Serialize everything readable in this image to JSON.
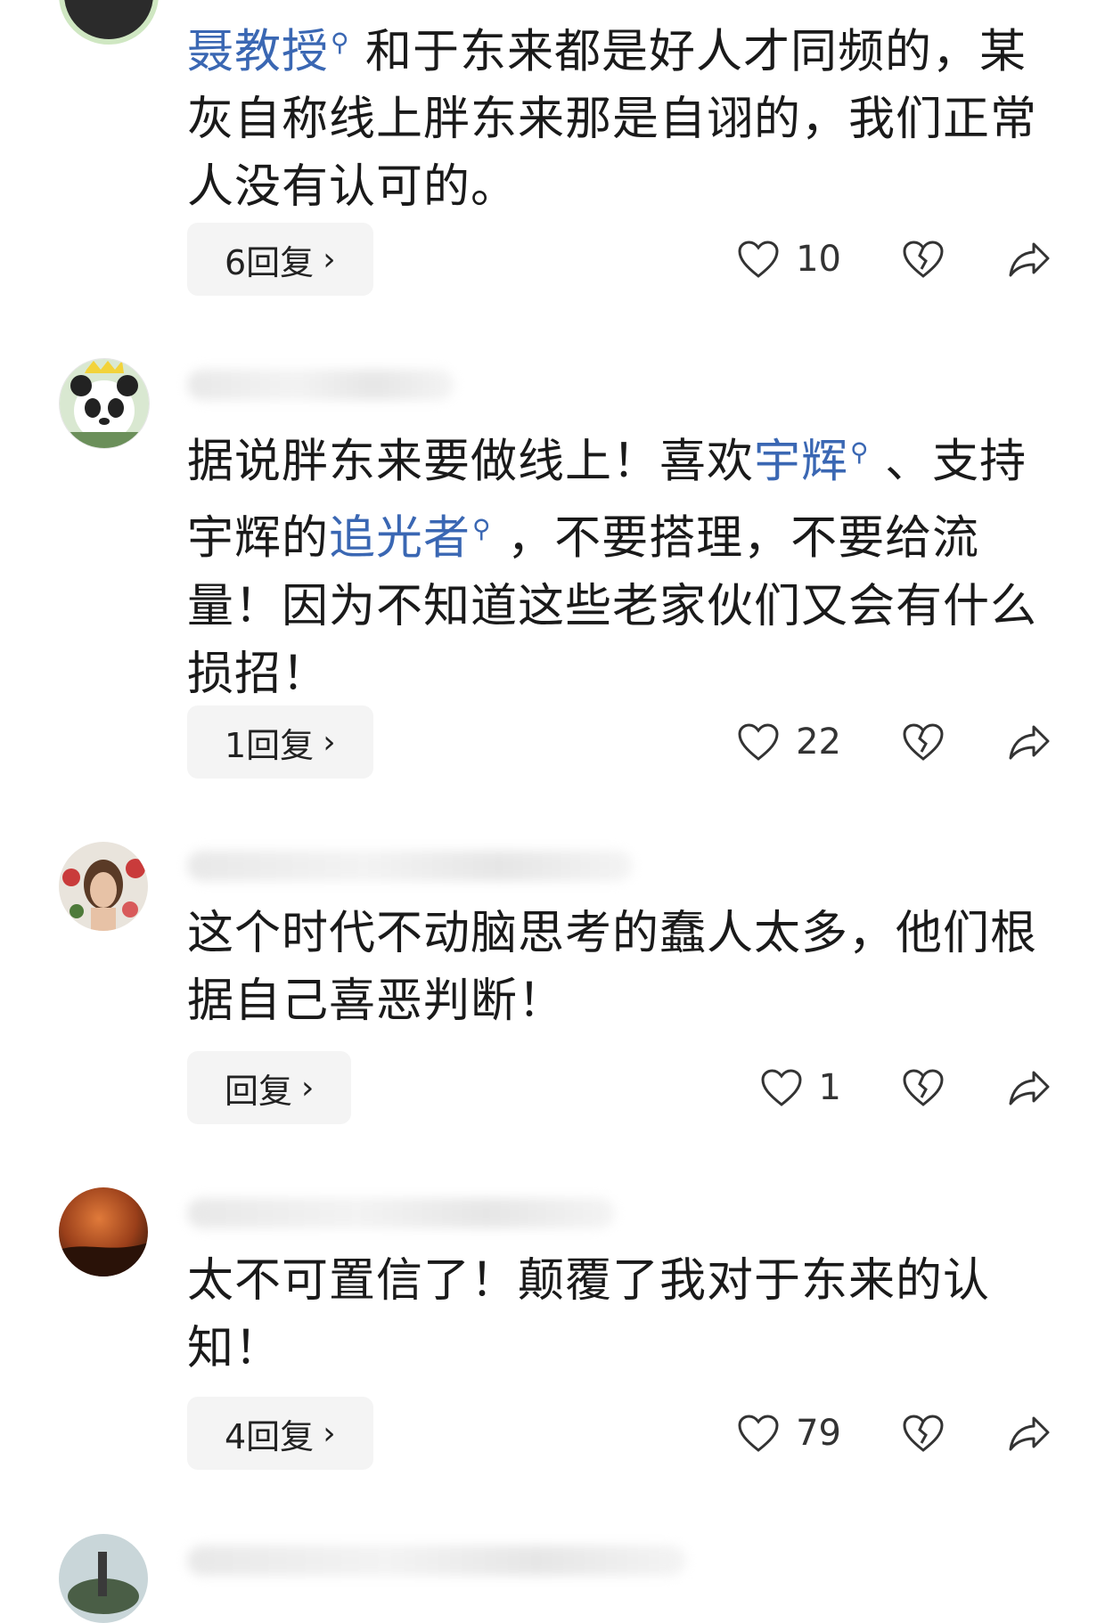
{
  "comments": [
    {
      "segments": [
        {
          "text": "聂教授",
          "mention": true
        },
        {
          "text": " 和于东来都是好人才同频的，某灰自称线上胖东来那是自诩的，我们正常人没有认可的。",
          "mention": false
        }
      ],
      "reply_label": "6回复",
      "likes": "10"
    },
    {
      "segments": [
        {
          "text": "据说胖东来要做线上！喜欢",
          "mention": false
        },
        {
          "text": "宇辉",
          "mention": true
        },
        {
          "text": " 、支持宇辉的",
          "mention": false
        },
        {
          "text": "追光者",
          "mention": true
        },
        {
          "text": " ，不要搭理，不要给流量！因为不知道这些老家伙们又会有什么损招！",
          "mention": false
        }
      ],
      "reply_label": "1回复",
      "likes": "22"
    },
    {
      "segments": [
        {
          "text": "这个时代不动脑思考的蠢人太多，他们根据自己喜恶判断！",
          "mention": false
        }
      ],
      "reply_label": "回复",
      "likes": "1"
    },
    {
      "segments": [
        {
          "text": "太不可置信了！颠覆了我对于东来的认知！",
          "mention": false
        }
      ],
      "reply_label": "4回复",
      "likes": "79"
    }
  ],
  "icons": {
    "search_marker": "search-icon",
    "like": "heart-icon",
    "dislike": "broken-heart-icon",
    "share": "share-arrow-icon"
  },
  "colors": {
    "mention": "#3a67b3",
    "text": "#1a1a1a",
    "reply_bg": "#f4f4f4"
  }
}
